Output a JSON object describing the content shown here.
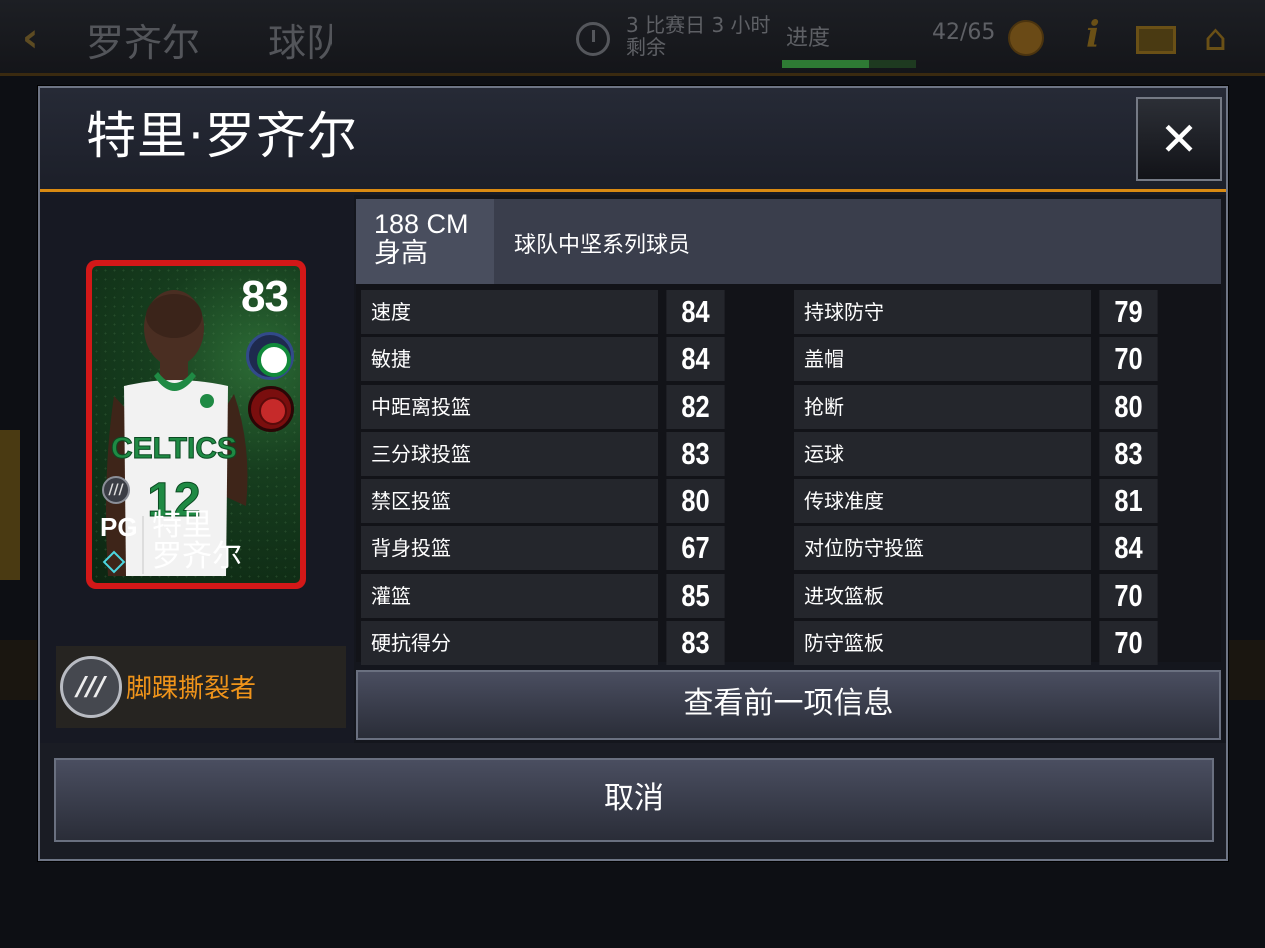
{
  "background": {
    "title_left": "罗齐尔",
    "title_right": "球队",
    "timer_text_line1": "3 比赛日 3 小时",
    "timer_text_line2": "剩余",
    "progress_label": "进度",
    "progress_fraction": 0.646,
    "progress_count": "42/65",
    "info_glyph": "i"
  },
  "modal": {
    "title": "特里·罗齐尔",
    "close_glyph": "✕",
    "card": {
      "rating": "83",
      "position": "PG",
      "name_line1": "特里",
      "name_line2": "罗齐尔",
      "jersey_text": "CELTICS",
      "jersey_number": "12",
      "border_color": "#d31818"
    },
    "ability": {
      "name": "脚踝撕裂者",
      "icon": "claw-icon"
    },
    "height_value": "188 CM",
    "height_label": "身高",
    "series": "球队中坚系列球员",
    "stats_left": [
      {
        "name": "速度",
        "value": "84"
      },
      {
        "name": "敏捷",
        "value": "84"
      },
      {
        "name": "中距离投篮",
        "value": "82"
      },
      {
        "name": "三分球投篮",
        "value": "83"
      },
      {
        "name": "禁区投篮",
        "value": "80"
      },
      {
        "name": "背身投篮",
        "value": "67"
      },
      {
        "name": "灌篮",
        "value": "85"
      },
      {
        "name": "硬抗得分",
        "value": "83"
      }
    ],
    "stats_right": [
      {
        "name": "持球防守",
        "value": "79"
      },
      {
        "name": "盖帽",
        "value": "70"
      },
      {
        "name": "抢断",
        "value": "80"
      },
      {
        "name": "运球",
        "value": "83"
      },
      {
        "name": "传球准度",
        "value": "81"
      },
      {
        "name": "对位防守投篮",
        "value": "84"
      },
      {
        "name": "进攻篮板",
        "value": "70"
      },
      {
        "name": "防守篮板",
        "value": "70"
      }
    ],
    "prev_button": "查看前一项信息",
    "cancel_button": "取消"
  },
  "colors": {
    "accent": "#d98a12",
    "ability_text": "#f0941a"
  }
}
